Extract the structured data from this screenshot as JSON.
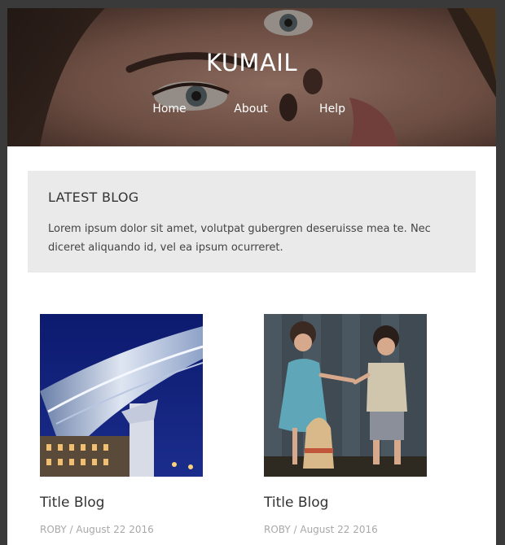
{
  "header": {
    "site_title": "KUMAIL",
    "nav": [
      {
        "label": "Home"
      },
      {
        "label": "About"
      },
      {
        "label": "Help"
      }
    ]
  },
  "latest": {
    "heading": "LATEST BLOG",
    "body": "Lorem ipsum dolor sit amet, volutpat gubergren deseruisse mea te. Nec diceret aliquando id, vel ea ipsum ocurreret."
  },
  "posts": [
    {
      "title": "Title Blog",
      "meta": "ROBY / August 22 2016"
    },
    {
      "title": "Title Blog",
      "meta": "ROBY / August 22 2016"
    }
  ],
  "colors": {
    "page_background": "#3a3a3a",
    "content_background": "#ffffff",
    "box_background": "#eaeaea",
    "meta_text": "#a8a8a8"
  }
}
